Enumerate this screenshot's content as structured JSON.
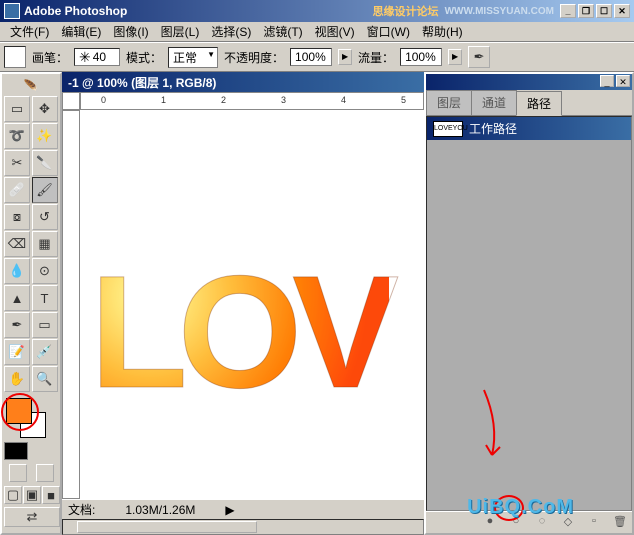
{
  "window": {
    "title": "Adobe Photoshop",
    "sponsor": "思缘设计论坛",
    "url": "WWW.MISSYUAN.COM",
    "min": "_",
    "restore": "❐",
    "max": "☐",
    "close": "✕"
  },
  "menu": {
    "file": "文件(F)",
    "edit": "编辑(E)",
    "image": "图像(I)",
    "layer": "图层(L)",
    "select": "选择(S)",
    "filter": "滤镜(T)",
    "view": "视图(V)",
    "window": "窗口(W)",
    "help": "帮助(H)"
  },
  "options": {
    "brush_label": "画笔：",
    "brush_size": "40",
    "mode_label": "模式：",
    "mode_value": "正常",
    "opacity_label": "不透明度：",
    "opacity_value": "100%",
    "flow_label": "流量：",
    "flow_value": "100%"
  },
  "document": {
    "title": "-1 @ 100% (图层 1, RGB/8)",
    "love_text": "LOV",
    "zoom": "",
    "filesize_label": "文档:",
    "filesize": "1.03M/1.26M"
  },
  "ruler_marks": [
    "0",
    "1",
    "2",
    "3",
    "4",
    "5"
  ],
  "panel": {
    "tab_layers": "图层",
    "tab_channels": "通道",
    "tab_paths": "路径",
    "path_name": "工作路径",
    "thumb_text": "LOVEYOU"
  },
  "watermark": "UiBQ.CoM",
  "colors": {
    "foreground": "#ff7f1a",
    "background": "#ffffff",
    "accent": "#0a246a"
  }
}
